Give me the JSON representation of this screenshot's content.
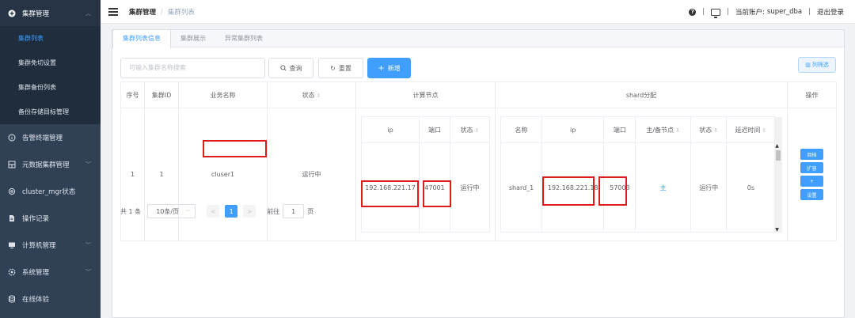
{
  "sidebar": {
    "group": {
      "label": "集群管理",
      "icon": "plus-circle-icon"
    },
    "sub_items": [
      {
        "label": "集群列表",
        "active": true
      },
      {
        "label": "集群免切设置"
      },
      {
        "label": "集群备份列表"
      },
      {
        "label": "备份存储目标管理"
      }
    ],
    "items": [
      {
        "label": "告警终端管理",
        "icon": "info-circle-icon",
        "chevron": false
      },
      {
        "label": "元数据集群管理",
        "icon": "grid-icon",
        "chevron": true
      },
      {
        "label": "cluster_mgr状态",
        "icon": "gear-icon",
        "chevron": false
      },
      {
        "label": "操作记录",
        "icon": "document-icon",
        "chevron": false
      },
      {
        "label": "计算机管理",
        "icon": "monitor-icon",
        "chevron": true
      },
      {
        "label": "系统管理",
        "icon": "settings-icon",
        "chevron": true
      },
      {
        "label": "在线体验",
        "icon": "database-icon",
        "chevron": false
      }
    ]
  },
  "header": {
    "breadcrumb": [
      "集群管理",
      "集群列表"
    ],
    "separator": "/",
    "help_icon": "?",
    "divider": "|",
    "account_label": "当前账户:",
    "username": "super_dba",
    "logout": "退出登录"
  },
  "tabs": [
    "集群列表信息",
    "集群展示",
    "异常集群列表"
  ],
  "toolbar": {
    "search_placeholder": "可输入集群名称搜索",
    "query_label": "查询",
    "reset_label": "重置",
    "add_label": "新增",
    "column_filter_label": "列筛选"
  },
  "table": {
    "headers": {
      "index": "序号",
      "cluster_id": "集群ID",
      "business_name": "业务名称",
      "status": "状态",
      "compute_nodes": "计算节点",
      "shard_alloc": "shard分配",
      "operations": "操作"
    },
    "row": {
      "index": "1",
      "cluster_id": "1",
      "business_name": "cluser1",
      "status": "运行中"
    },
    "compute_nodes": {
      "headers": [
        "ip",
        "端口",
        "状态"
      ],
      "rows": [
        {
          "ip": "192.168.221.17",
          "port": "47001",
          "status": "运行中"
        }
      ]
    },
    "shards": {
      "headers": [
        "名称",
        "ip",
        "端口",
        "主/备节点",
        "状态",
        "延迟时间"
      ],
      "rows": [
        {
          "name": "shard_1",
          "ip": "192.168.221.18",
          "port": "57003",
          "role": "主",
          "status": "运行中",
          "delay": "0s"
        }
      ]
    },
    "operations": [
      "回档",
      "扩容",
      "+",
      "设置"
    ]
  },
  "pagination": {
    "total": "共 1 条",
    "page_size": "10条/页",
    "prev": "<",
    "current_page": "1",
    "next": ">",
    "goto_prefix": "前往",
    "goto_value": "1",
    "goto_suffix": "页"
  },
  "colors": {
    "sidebar_bg": "#304156",
    "sidebar_sub_bg": "#1f2d3d",
    "accent": "#409eff",
    "running": "#67c23a",
    "highlight": "#e0191a"
  }
}
